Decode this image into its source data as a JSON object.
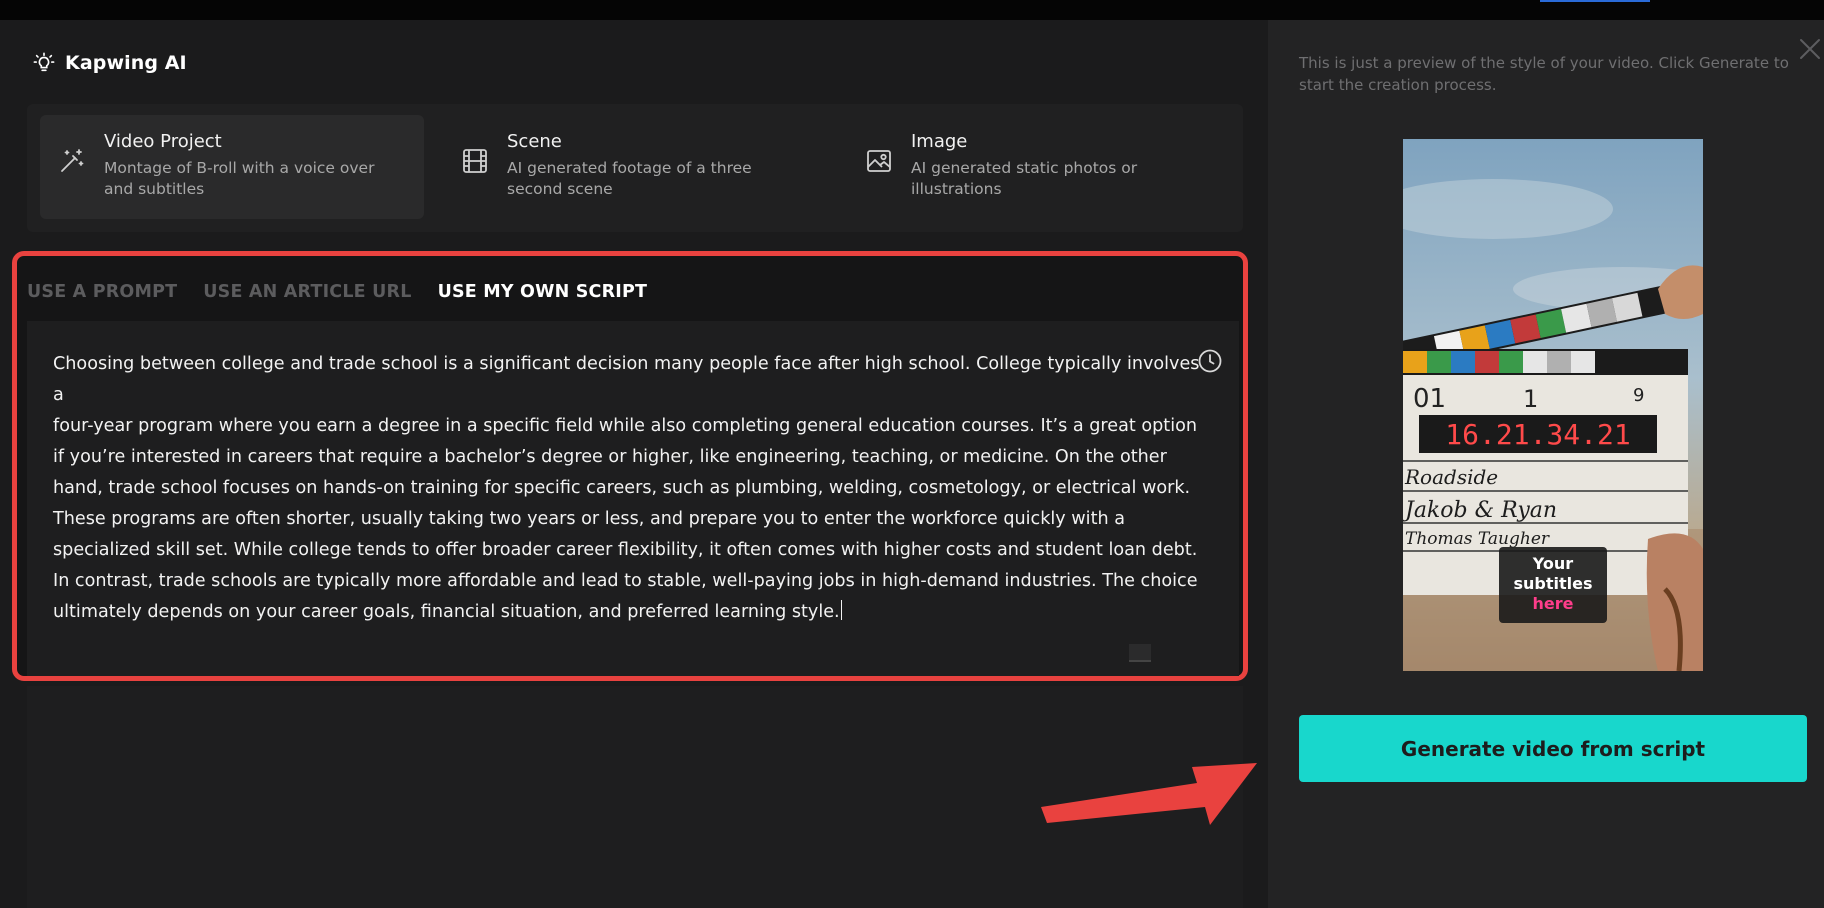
{
  "header": {
    "title": "Kapwing AI",
    "icon": "lightbulb-icon"
  },
  "types": [
    {
      "title": "Video Project",
      "desc": "Montage of B-roll with a voice over and subtitles",
      "icon": "magic-wand-icon",
      "active": true
    },
    {
      "title": "Scene",
      "desc": "AI generated footage of a three second scene",
      "icon": "film-icon",
      "active": false
    },
    {
      "title": "Image",
      "desc": "AI generated static photos or illustrations",
      "icon": "image-icon",
      "active": false
    }
  ],
  "tabs": [
    {
      "label": "USE A PROMPT",
      "active": false
    },
    {
      "label": "USE AN ARTICLE URL",
      "active": false
    },
    {
      "label": "USE MY OWN SCRIPT",
      "active": true
    }
  ],
  "script": {
    "lines": [
      "Choosing between college and trade school is a significant decision many people face after high school. College typically involves a",
      "four-year program where you earn a degree in a specific field while also completing general education courses. It’s a great option",
      "if you’re interested in careers that require a bachelor’s degree or higher, like engineering, teaching, or medicine. On the other",
      "hand, trade school focuses on hands-on training for specific careers, such as plumbing, welding, cosmetology, or electrical work.",
      "These programs are often shorter, usually taking two years or less, and prepare you to enter the workforce quickly with a",
      "specialized skill set. While college tends to offer broader career flexibility, it often comes with higher costs and student loan debt.",
      "In contrast, trade schools are typically more affordable and lead to stable, well-paying jobs in high-demand industries. The choice",
      "ultimately depends on your career goals, financial situation, and preferred learning style."
    ]
  },
  "preview": {
    "note": "This is just a preview of the style of your video. Click Generate to start the creation process.",
    "clapper": {
      "scene": "01",
      "take": "1",
      "roll": "9",
      "timecode": "16.21.34.21",
      "line1": "Roadside",
      "line2": "Jakob & Ryan",
      "line3": "Thomas Taugher"
    },
    "subtitle": {
      "line1": "Your",
      "line2": "subtitles",
      "line3": "here",
      "highlight_color": "#ff3d8b"
    }
  },
  "generate_button": {
    "label": "Generate video from script"
  },
  "colors": {
    "accent": "#18d7cc",
    "annotation": "#e9423f"
  }
}
